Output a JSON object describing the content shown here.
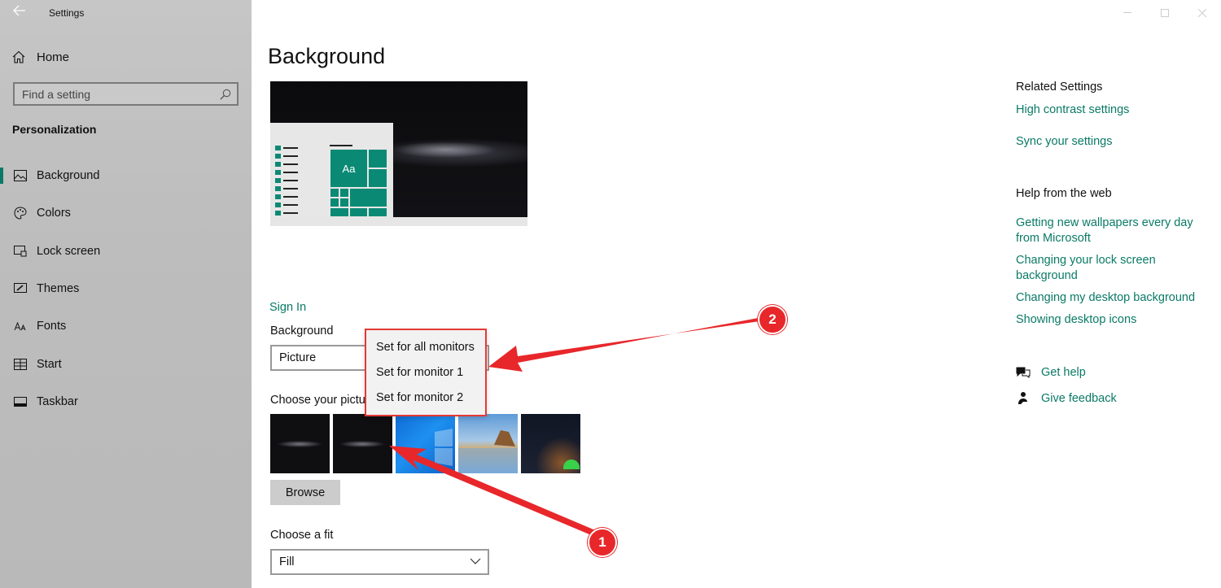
{
  "app": {
    "title": "Settings"
  },
  "sidebar": {
    "home_label": "Home",
    "search_placeholder": "Find a setting",
    "section_title": "Personalization",
    "items": [
      {
        "label": "Background",
        "icon": "picture-icon",
        "active": true
      },
      {
        "label": "Colors",
        "icon": "palette-icon",
        "active": false
      },
      {
        "label": "Lock screen",
        "icon": "lock-screen-icon",
        "active": false
      },
      {
        "label": "Themes",
        "icon": "themes-icon",
        "active": false
      },
      {
        "label": "Fonts",
        "icon": "fonts-icon",
        "active": false
      },
      {
        "label": "Start",
        "icon": "start-icon",
        "active": false
      },
      {
        "label": "Taskbar",
        "icon": "taskbar-icon",
        "active": false
      }
    ]
  },
  "main": {
    "title": "Background",
    "preview_tile_text": "Aa",
    "sign_in_link": "Sign In",
    "background_label": "Background",
    "background_value": "Picture",
    "choose_picture_label": "Choose your picture",
    "browse_label": "Browse",
    "fit_label": "Choose a fit",
    "fit_value": "Fill"
  },
  "context_menu": {
    "items": [
      "Set for all monitors",
      "Set for monitor 1",
      "Set for monitor 2"
    ]
  },
  "related": {
    "heading": "Related Settings",
    "links": [
      "High contrast settings",
      "Sync your settings"
    ]
  },
  "help": {
    "heading": "Help from the web",
    "links": [
      "Getting new wallpapers every day from Microsoft",
      "Changing your lock screen background",
      "Changing my desktop background",
      "Showing desktop icons"
    ],
    "get_help": "Get help",
    "give_feedback": "Give feedback"
  },
  "annotations": {
    "badge1": "1",
    "badge2": "2",
    "color": "#e8272b"
  },
  "colors": {
    "accent": "#0a7a66",
    "sidebar_bg": "#c0c0c0"
  }
}
